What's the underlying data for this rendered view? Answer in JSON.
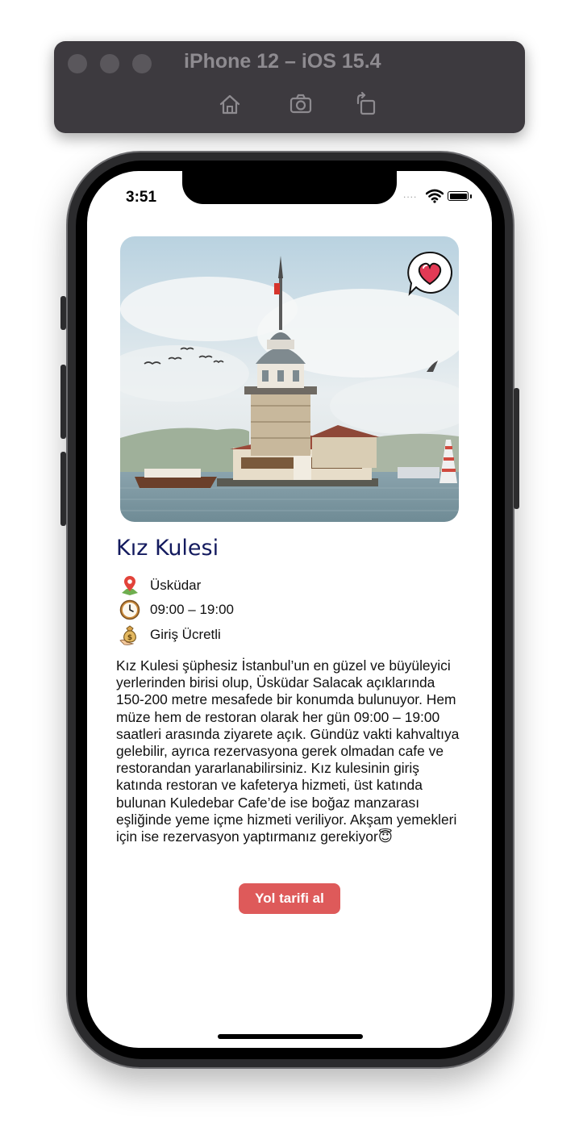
{
  "simulator": {
    "title": "iPhone 12 – iOS 15.4",
    "tools": [
      "home-icon",
      "screenshot-icon",
      "rotate-icon"
    ]
  },
  "status_bar": {
    "time": "3:51",
    "signal_dots": "....",
    "icons": [
      "wifi-icon",
      "battery-icon"
    ]
  },
  "place": {
    "title": "Kız Kulesi",
    "favorite_icon": "heart-speech-bubble-icon",
    "location": "Üsküdar",
    "hours": "09:00 – 19:00",
    "fee": "Giriş Ücretli",
    "description": "Kız Kulesi şüphesiz İstanbul’un en güzel ve büyüleyici yerlerinden birisi olup, Üsküdar Salacak açıklarında 150-200 metre mesafede bir konumda bulunuyor. Hem müze hem de restoran olarak her gün 09:00 – 19:00 saatleri arasında ziyarete açık. Gündüz vakti kahvaltıya gelebilir, ayrıca rezervasyona gerek olmadan cafe ve restorandan yararlanabilirsiniz. Kız kulesinin giriş katında restoran ve kafeterya hizmeti, üst katında bulunan Kuledebar Cafe’de ise boğaz manzarası eşliğinde yeme içme hizmeti veriliyor. Akşam yemekleri için ise rezervasyon yaptırmanız gerekiyor😇",
    "directions_button": "Yol tarifi al"
  },
  "colors": {
    "title": "#131a5e",
    "button": "#de5a5a",
    "sim_bar": "#3d3a3f"
  }
}
